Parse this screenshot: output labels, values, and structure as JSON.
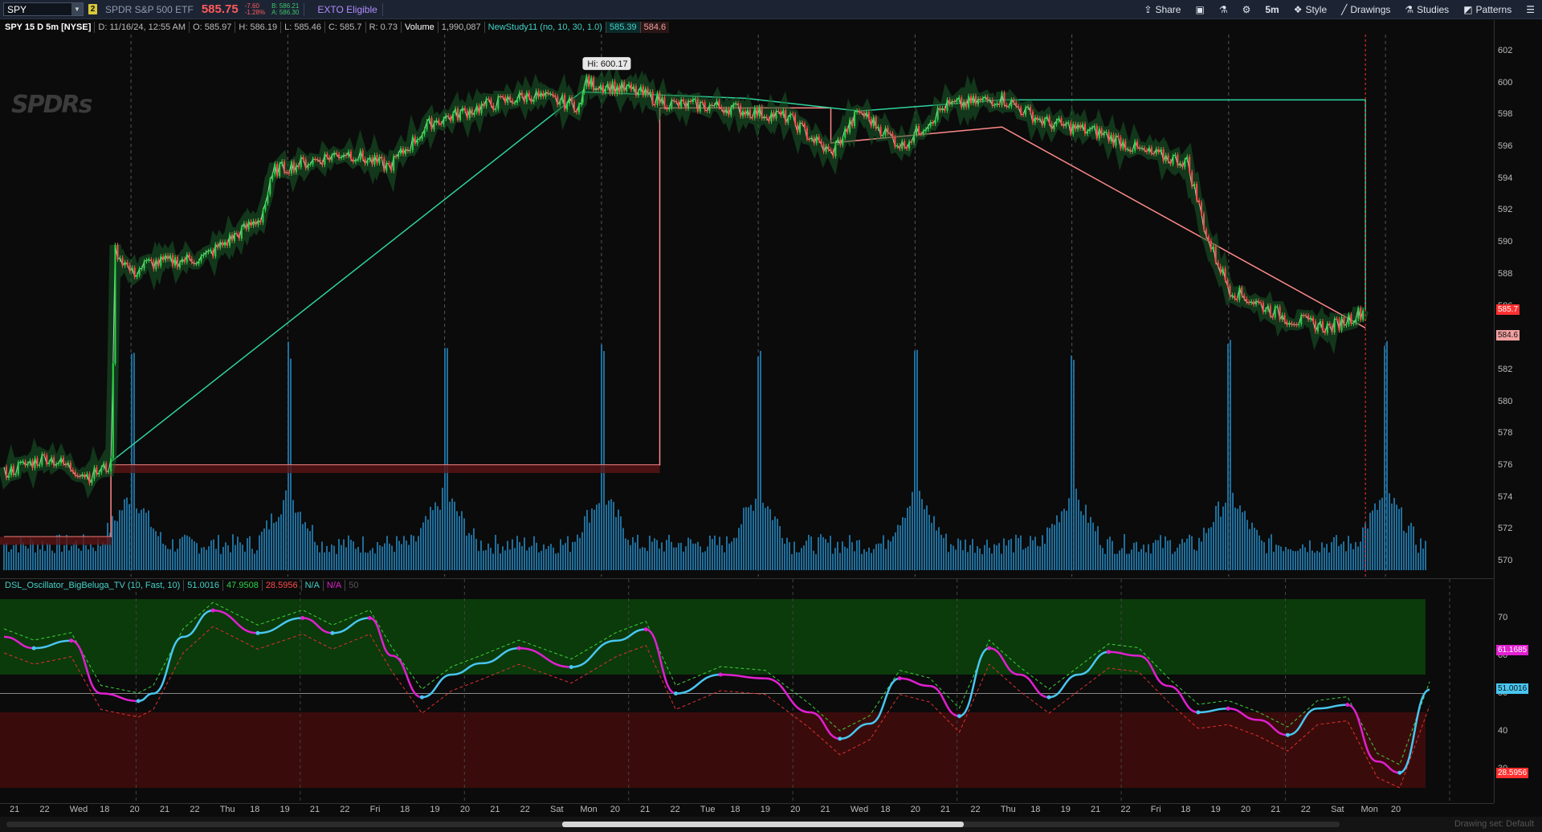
{
  "toolbar": {
    "symbol": "SPY",
    "badge": "2",
    "description": "SPDR S&P 500 ETF",
    "last_price": "585.75",
    "change": "-7.60",
    "change_pct": "-1.28%",
    "bid": "B: 586.21",
    "ask": "A: 586.30",
    "exto": "EXTO Eligible",
    "share": "Share",
    "timeframe": "5m",
    "style": "Style",
    "drawings": "Drawings",
    "studies": "Studies",
    "patterns": "Patterns"
  },
  "header": {
    "title": "SPY 15 D 5m [NYSE]",
    "date": "D: 11/16/24, 12:55 AM",
    "open": "O: 585.97",
    "high": "H: 586.19",
    "low": "L: 585.46",
    "close": "C: 585.7",
    "range": "R: 0.73",
    "volume_label": "Volume",
    "volume_value": "1,990,087",
    "study_name": "NewStudy11 (no, 10, 30, 1.0)",
    "study_v1": "585.39",
    "study_v2": "584.6"
  },
  "oscillator": {
    "name": "DSL_Oscillator_BigBeluga_TV (10, Fast, 10)",
    "v1": "51.0016",
    "v2": "47.9508",
    "v3": "28.5956",
    "v4": "N/A",
    "v5": "N/A",
    "v6": "50"
  },
  "chart_annotation": {
    "hi": "Hi: 600.17"
  },
  "logo": "SPDRs",
  "price_axis": [
    "602",
    "600",
    "598",
    "596",
    "594",
    "592",
    "590",
    "588",
    "586",
    "584",
    "582",
    "580",
    "578",
    "576",
    "574",
    "572",
    "570"
  ],
  "price_boxes": {
    "last": "585.7",
    "study": "584.6"
  },
  "osc_axis": [
    "70",
    "60",
    "50",
    "40",
    "30"
  ],
  "osc_boxes": {
    "upper": "61.1685",
    "mid": "51.0016",
    "lower": "28.5956"
  },
  "time_axis": [
    "21",
    "22",
    "Wed",
    "18",
    "20",
    "21",
    "22",
    "Thu",
    "18",
    "19",
    "21",
    "22",
    "Fri",
    "18",
    "19",
    "20",
    "21",
    "22",
    "Sat",
    "Mon",
    "20",
    "21",
    "22",
    "Tue",
    "18",
    "19",
    "20",
    "21",
    "Wed",
    "18",
    "20",
    "21",
    "22",
    "Thu",
    "18",
    "19",
    "21",
    "22",
    "Fri",
    "18",
    "19",
    "20",
    "21",
    "22",
    "Sat",
    "Mon",
    "20"
  ],
  "status": "Drawing set: Default",
  "colors": {
    "up": "#2fd34a",
    "down": "#ff4a4a",
    "teal": "#42d2c7",
    "volume": "#1f6e9c",
    "magenta": "#e020d0",
    "osc_cyan": "#49c6f0"
  },
  "chart_data": [
    {
      "type": "line",
      "title": "SPY 15 D 5m [NYSE]",
      "ylim": [
        569,
        603
      ],
      "x_sessions": [
        "Tue",
        "Wed",
        "Thu",
        "Fri",
        "Mon",
        "Tue",
        "Wed",
        "Thu",
        "Fri"
      ],
      "price_path": [
        [
          0,
          575.5
        ],
        [
          0.03,
          576.5
        ],
        [
          0.06,
          575.3
        ],
        [
          0.075,
          576.0
        ],
        [
          0.078,
          589.5
        ],
        [
          0.09,
          588.0
        ],
        [
          0.1,
          588.6
        ],
        [
          0.14,
          589.0
        ],
        [
          0.18,
          591.5
        ],
        [
          0.19,
          594.5
        ],
        [
          0.24,
          595.6
        ],
        [
          0.27,
          594.7
        ],
        [
          0.3,
          597.5
        ],
        [
          0.34,
          598.6
        ],
        [
          0.37,
          599.2
        ],
        [
          0.405,
          598.5
        ],
        [
          0.407,
          600.0
        ],
        [
          0.44,
          599.5
        ],
        [
          0.47,
          598.6
        ],
        [
          0.5,
          598.5
        ],
        [
          0.55,
          597.8
        ],
        [
          0.58,
          595.5
        ],
        [
          0.6,
          598.2
        ],
        [
          0.63,
          596.0
        ],
        [
          0.66,
          598.5
        ],
        [
          0.7,
          599.0
        ],
        [
          0.73,
          597.5
        ],
        [
          0.77,
          596.8
        ],
        [
          0.8,
          595.6
        ],
        [
          0.83,
          595.0
        ],
        [
          0.845,
          590.0
        ],
        [
          0.86,
          587.0
        ],
        [
          0.9,
          585.2
        ],
        [
          0.93,
          584.6
        ],
        [
          0.955,
          585.7
        ]
      ],
      "volume_spikes_x": [
        0.075,
        0.185,
        0.295,
        0.405,
        0.515,
        0.625,
        0.735,
        0.845,
        0.955
      ],
      "study_upper_x": [
        0.075,
        0.405,
        0.52,
        0.6,
        0.7,
        0.955
      ],
      "study_upper_y": [
        576.2,
        599.4,
        599.0,
        598.2,
        598.9,
        598.9
      ],
      "study_lower_x": [
        0,
        0.075,
        0.075,
        0.46,
        0.46,
        0.58,
        0.58,
        0.7,
        0.955
      ],
      "study_lower_y": [
        571.5,
        571.5,
        576.0,
        576.0,
        598.4,
        598.4,
        596.2,
        597.2,
        584.6
      ]
    },
    {
      "type": "line",
      "title": "DSL_Oscillator_BigBeluga_TV (10, Fast, 10)",
      "ylim": [
        25,
        75
      ],
      "zones": {
        "upper": [
          55,
          75
        ],
        "lower": [
          25,
          45
        ],
        "mid": 50
      },
      "x": [
        0,
        0.02,
        0.045,
        0.065,
        0.09,
        0.1,
        0.12,
        0.14,
        0.17,
        0.2,
        0.22,
        0.245,
        0.26,
        0.28,
        0.3,
        0.32,
        0.345,
        0.38,
        0.41,
        0.43,
        0.45,
        0.48,
        0.51,
        0.54,
        0.56,
        0.58,
        0.6,
        0.62,
        0.64,
        0.66,
        0.68,
        0.7,
        0.72,
        0.74,
        0.76,
        0.78,
        0.8,
        0.82,
        0.84,
        0.86,
        0.88,
        0.9,
        0.92,
        0.935,
        0.955
      ],
      "values": [
        65,
        62,
        64,
        50,
        48,
        50,
        65,
        72,
        66,
        70,
        66,
        70,
        60,
        49,
        55,
        58,
        62,
        57,
        64,
        67,
        50,
        55,
        54,
        45,
        38,
        42,
        54,
        52,
        44,
        62,
        55,
        49,
        55,
        61,
        60,
        52,
        45,
        46,
        43,
        39,
        46,
        47,
        32,
        29,
        51
      ]
    }
  ]
}
